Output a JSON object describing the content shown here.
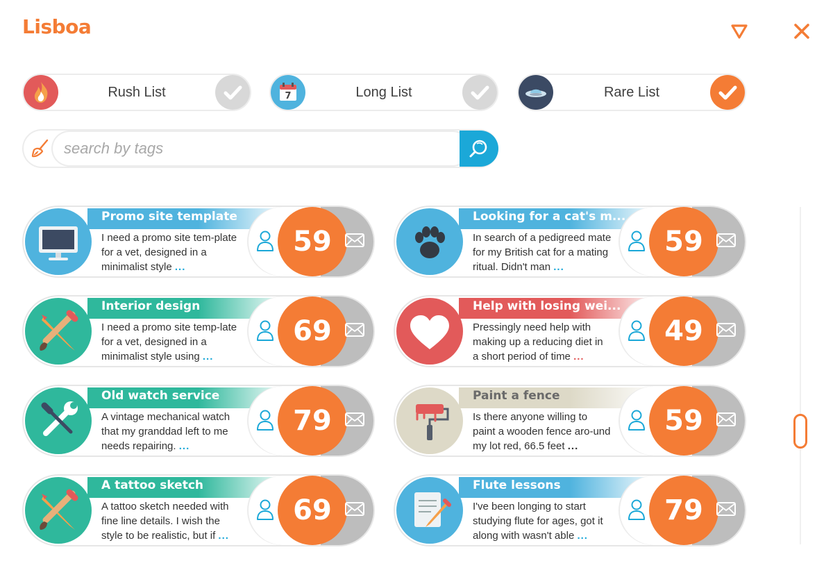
{
  "app": {
    "title": "Lisboa"
  },
  "header": {
    "filter_icon": "triangle-down-icon",
    "close_icon": "close-icon",
    "accent": "#f47c35"
  },
  "lists": [
    {
      "label": "Rush List",
      "icon": "flame-icon",
      "checked": false
    },
    {
      "label": "Long List",
      "icon": "calendar-icon",
      "calendar_day": "7",
      "checked": false
    },
    {
      "label": "Rare List",
      "icon": "ufo-icon",
      "checked": true
    }
  ],
  "search": {
    "placeholder": "search by tags",
    "value": "",
    "clear_icon": "broom-icon",
    "search_icon": "search-icon"
  },
  "cards": [
    {
      "title": "Promo site template",
      "desc": "I need a promo site tem-plate for a vet, designed in a minimalist style",
      "more": "...",
      "score": "59",
      "icon": "monitor-icon",
      "color": "#4fb3de"
    },
    {
      "title": "Looking for a cat's m...",
      "desc": "In search of a pedigreed mate for my British cat for a mating ritual. Didn't man",
      "more": "...",
      "score": "59",
      "icon": "paw-icon",
      "color": "#4fb3de"
    },
    {
      "title": "Interior design",
      "desc": "I need a promo site temp-late for a vet, designed in a minimalist style using",
      "more": "...",
      "score": "69",
      "icon": "pencil-brush-icon",
      "color": "#2fb89c"
    },
    {
      "title": "Help with losing wei...",
      "desc": "Pressingly need help with making up a reducing diet in a short period of time",
      "more": "...",
      "score": "49",
      "icon": "heart-icon",
      "color": "#e25a5a"
    },
    {
      "title": "Old watch service",
      "desc": "A vintage mechanical watch that my granddad left to me needs repairing.",
      "more": "...",
      "score": "79",
      "icon": "wrench-screwdriver-icon",
      "color": "#2fb89c"
    },
    {
      "title": "Paint a fence",
      "desc": "Is there anyone willing to paint a wooden fence aro-und my lot red, 66.5 feet",
      "more": "...",
      "score": "59",
      "icon": "paint-roller-icon",
      "color": "#ddd9c7"
    },
    {
      "title": "A tattoo sketch",
      "desc": "A tattoo sketch needed with fine line details. I wish the style to be realistic, but if",
      "more": "...",
      "score": "69",
      "icon": "pencil-brush-icon",
      "color": "#2fb89c"
    },
    {
      "title": "Flute lessons",
      "desc": "I've been longing to start studying flute for ages, got it along with wasn't able",
      "more": "...",
      "score": "79",
      "icon": "notepad-pencil-icon",
      "color": "#4fb3de"
    }
  ]
}
